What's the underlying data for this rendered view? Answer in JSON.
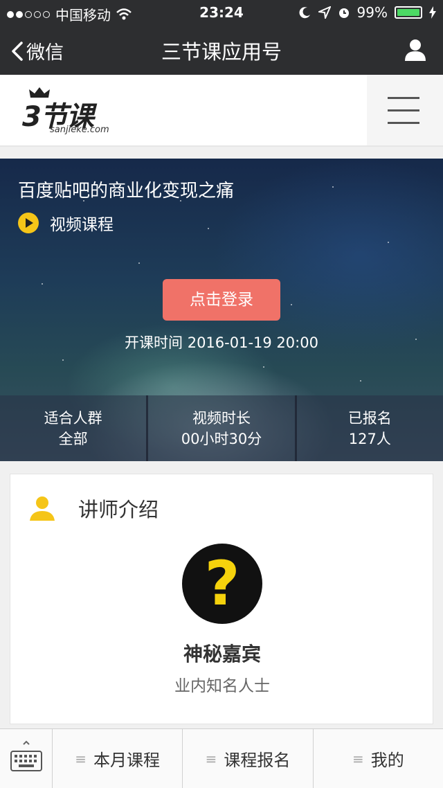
{
  "status_bar": {
    "carrier": "中国移动",
    "time": "23:24",
    "battery": "99%",
    "signal_dots_filled": 2,
    "signal_dots_total": 5,
    "battery_level": 0.99
  },
  "nav": {
    "back_label": "微信",
    "title": "三节课应用号"
  },
  "site": {
    "logo_text": "3节课",
    "logo_domain": "sanjieke.com"
  },
  "course": {
    "title": "百度贴吧的商业化变现之痛",
    "type": "视频课程",
    "login_button": "点击登录",
    "start_time": "开课时间 2016-01-19 20:00",
    "stats": [
      {
        "label": "适合人群",
        "value": "全部"
      },
      {
        "label": "视频时长",
        "value": "00小时30分"
      },
      {
        "label": "已报名",
        "value": "127人"
      }
    ]
  },
  "teacher": {
    "section_title": "讲师介绍",
    "avatar_symbol": "?",
    "name": "神秘嘉宾",
    "desc": "业内知名人士"
  },
  "tabbar": {
    "tabs": [
      {
        "icon": "≡",
        "label": "本月课程"
      },
      {
        "icon": "≡",
        "label": "课程报名"
      },
      {
        "icon": "≡",
        "label": "我的"
      }
    ]
  },
  "icons": {
    "signal": "signal-dots-icon",
    "wifi": "wifi-icon",
    "moon": "moon-icon",
    "location": "location-arrow-icon",
    "alarm": "alarm-icon",
    "battery": "battery-icon",
    "charging": "charging-bolt-icon",
    "back": "chevron-left-icon",
    "user": "user-icon",
    "menu": "hamburger-menu-icon",
    "play": "play-icon",
    "teacher": "person-icon",
    "keyboard": "keyboard-icon"
  },
  "colors": {
    "topbar": "#2d2e30",
    "login_button": "#f07268",
    "play_icon": "#f5c518",
    "battery_fill": "#4cd964",
    "avatar_question": "#f5d20c"
  }
}
